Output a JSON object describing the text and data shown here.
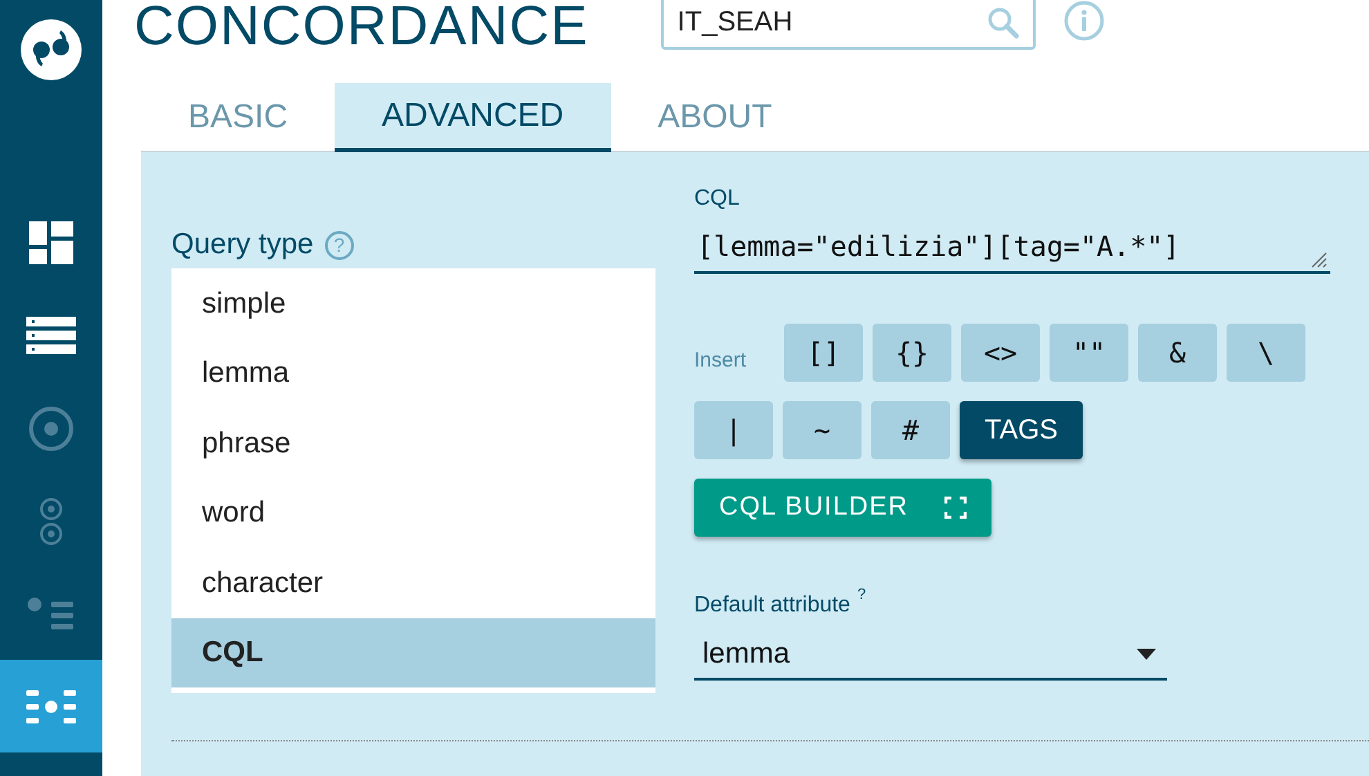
{
  "header": {
    "title": "CONCORDANCE",
    "corpus_field": {
      "value": "IT_SEAH"
    }
  },
  "sidebar": {
    "items": [
      {
        "selected": false,
        "disabled": false
      },
      {
        "selected": false,
        "disabled": false
      },
      {
        "selected": false,
        "disabled": true
      },
      {
        "selected": false,
        "disabled": true
      },
      {
        "selected": false,
        "disabled": true
      },
      {
        "selected": true,
        "disabled": false
      }
    ]
  },
  "tabs": [
    {
      "label": "BASIC",
      "selected": false
    },
    {
      "label": "ADVANCED",
      "selected": true
    },
    {
      "label": "ABOUT",
      "selected": false
    }
  ],
  "query_type": {
    "label": "Query type",
    "help": "?",
    "options": [
      {
        "label": "simple",
        "selected": false
      },
      {
        "label": "lemma",
        "selected": false
      },
      {
        "label": "phrase",
        "selected": false
      },
      {
        "label": "word",
        "selected": false
      },
      {
        "label": "character",
        "selected": false
      },
      {
        "label": "CQL",
        "selected": true
      }
    ]
  },
  "cql": {
    "label": "CQL",
    "value": "[lemma=\"edilizia\"][tag=\"A.*\"]"
  },
  "insert": {
    "label": "Insert",
    "buttons": [
      {
        "label": "[]",
        "kind": "symbol"
      },
      {
        "label": "{}",
        "kind": "symbol"
      },
      {
        "label": "<>",
        "kind": "symbol"
      },
      {
        "label": "\"\"",
        "kind": "symbol"
      },
      {
        "label": "&",
        "kind": "symbol"
      },
      {
        "label": "\\",
        "kind": "symbol"
      },
      {
        "label": "|",
        "kind": "symbol"
      },
      {
        "label": "~",
        "kind": "symbol"
      },
      {
        "label": "#",
        "kind": "symbol"
      },
      {
        "label": "TAGS",
        "kind": "tags"
      }
    ]
  },
  "cql_builder": {
    "label": "CQL BUILDER"
  },
  "default_attribute": {
    "label": "Default attribute",
    "help": "?",
    "value": "lemma"
  }
}
